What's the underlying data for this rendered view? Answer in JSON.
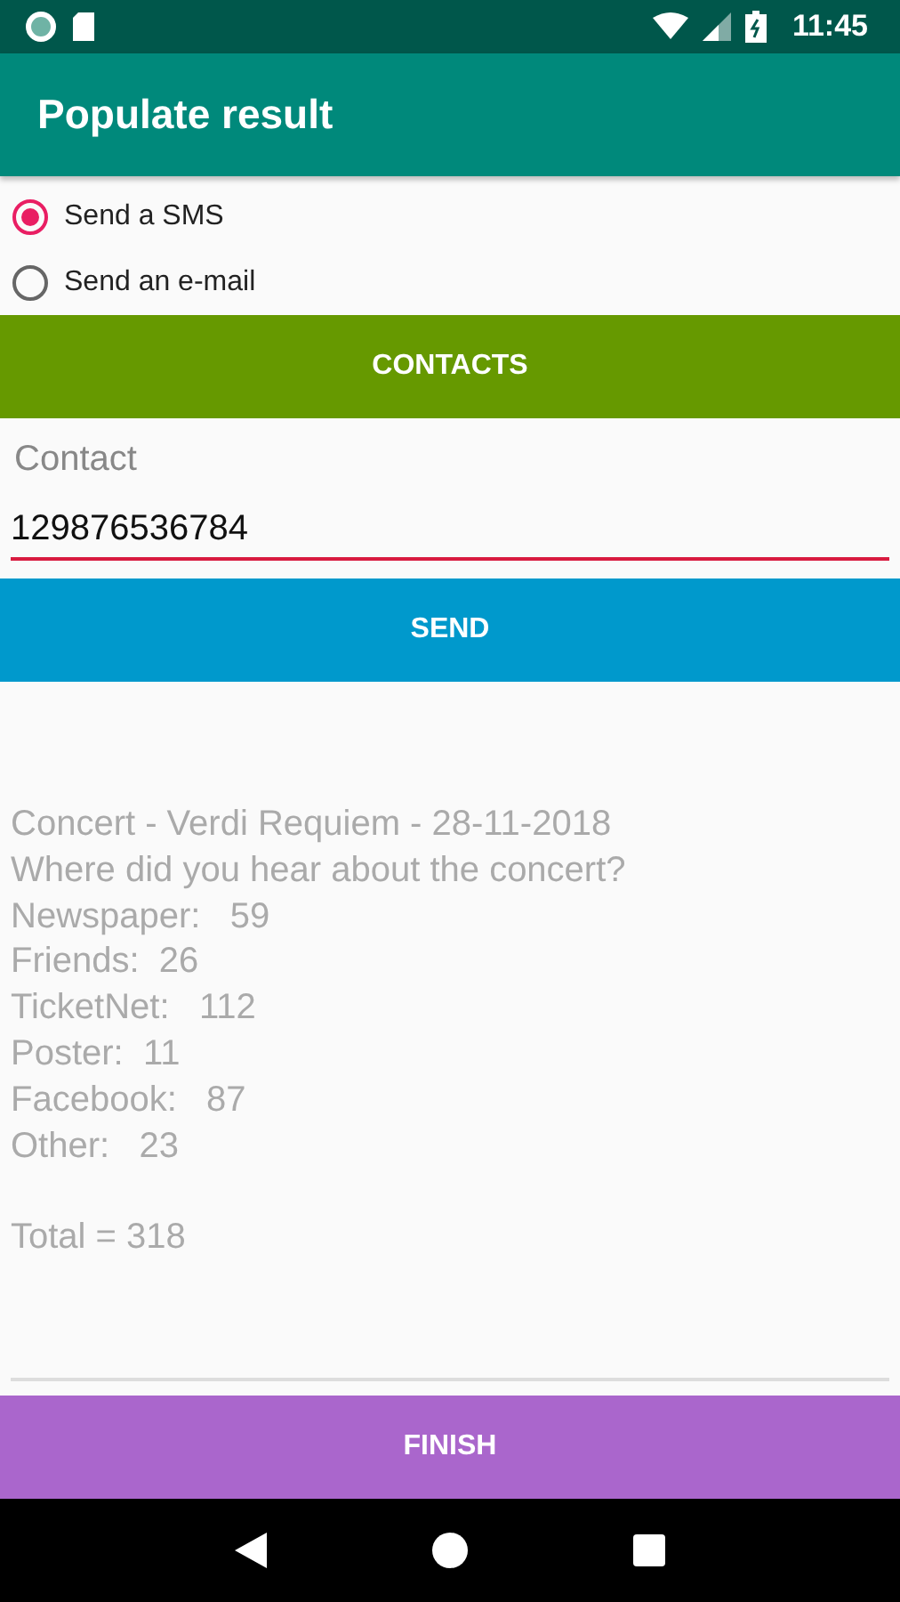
{
  "status_bar": {
    "time": "11:45"
  },
  "app_bar": {
    "title": "Populate result"
  },
  "radios": [
    {
      "label": "Send a SMS",
      "selected": true
    },
    {
      "label": "Send an e-mail",
      "selected": false
    }
  ],
  "contacts_button": "CONTACTS",
  "contact_field": {
    "label": "Contact",
    "value": "129876536784"
  },
  "send_button": "SEND",
  "result": {
    "lines": [
      "Concert - Verdi Requiem - 28-11-2018",
      "Where did you hear about the concert?",
      "Newspaper:   59",
      "Friends:  26",
      "TicketNet:   112",
      "Poster:  11",
      "Facebook:   87",
      "Other:   23"
    ],
    "total": "Total = 318"
  },
  "finish_button": "FINISH"
}
